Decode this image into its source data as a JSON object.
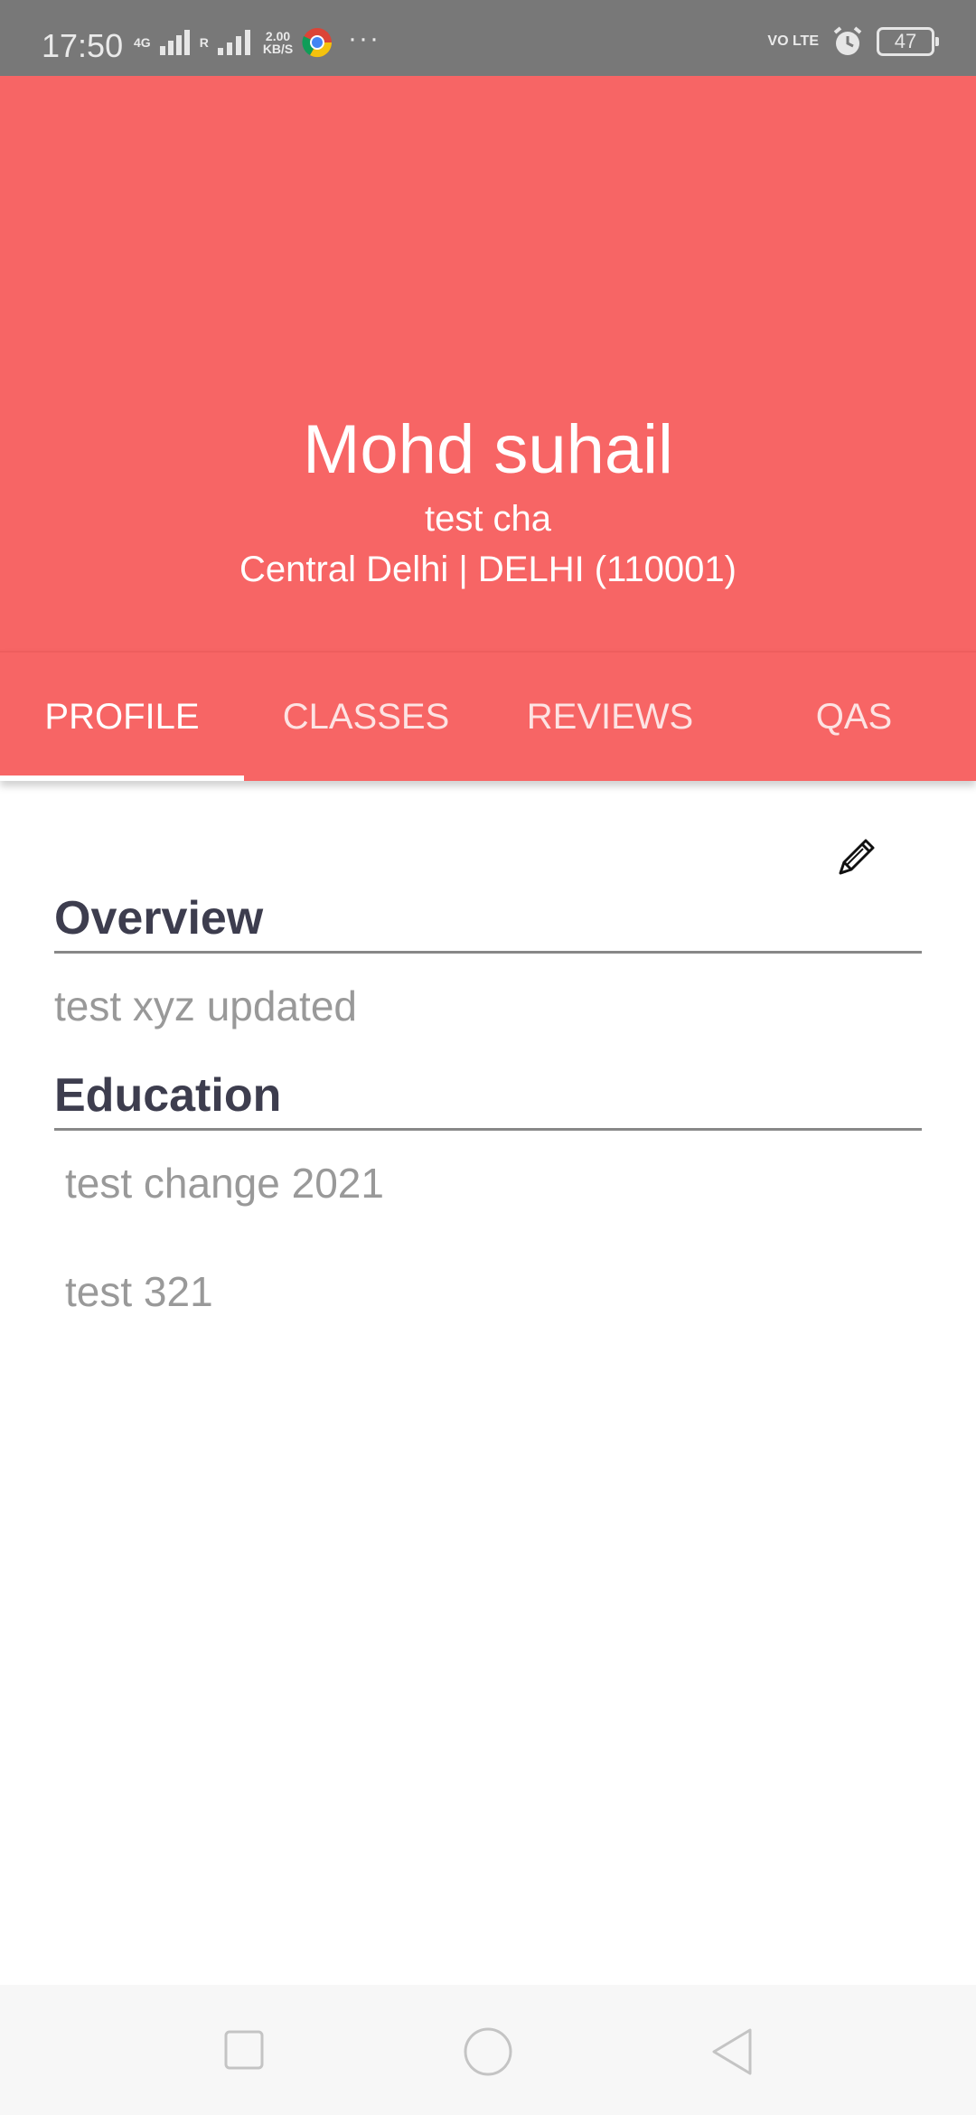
{
  "status_bar": {
    "time": "17:50",
    "network_type": "4G",
    "roaming": "R",
    "speed_value": "2.00",
    "speed_unit": "KB/S",
    "more": "···",
    "volte": "VO LTE",
    "battery": "47"
  },
  "profile": {
    "name": "Mohd suhail",
    "subtitle": "test cha",
    "location": "Central Delhi | DELHI (110001)"
  },
  "tabs": [
    {
      "label": "PROFILE",
      "active": true
    },
    {
      "label": "CLASSES",
      "active": false
    },
    {
      "label": "REVIEWS",
      "active": false
    },
    {
      "label": "QAS",
      "active": false
    }
  ],
  "overview": {
    "title": "Overview",
    "text": "test xyz updated"
  },
  "education": {
    "title": "Education",
    "items": [
      "test change 2021",
      "test 321"
    ]
  },
  "icons": {
    "edit": "pencil-icon",
    "nav_recent": "square-icon",
    "nav_home": "circle-icon",
    "nav_back": "triangle-back-icon"
  },
  "colors": {
    "accent": "#f76565",
    "status_bar": "#787878",
    "heading": "#3d3d4e",
    "body_text": "#999999"
  }
}
